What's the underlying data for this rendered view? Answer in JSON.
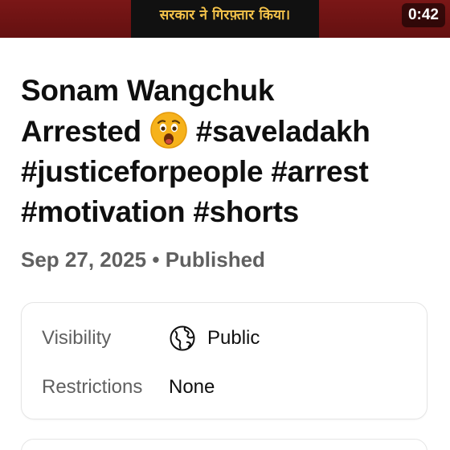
{
  "thumbnail": {
    "caption": "सरकार ने गिरफ़्तार किया।",
    "duration": "0:42"
  },
  "video": {
    "title_line1": "Sonam Wangchuk",
    "title_line2_word": "Arrested",
    "title_line2_tag": "#saveladakh",
    "title_line3": "#justiceforpeople #arrest",
    "title_line4": "#motivation #shorts",
    "emoji": "face-with-open-mouth-icon",
    "date": "Sep 27, 2025",
    "separator": "•",
    "status": "Published"
  },
  "details": {
    "visibility_label": "Visibility",
    "visibility_value": "Public",
    "visibility_icon": "globe-icon",
    "restrictions_label": "Restrictions",
    "restrictions_value": "None"
  },
  "colors": {
    "title": "#0f0f0f",
    "secondary": "#606060",
    "thumbnail_bg": "#6f1414",
    "thumbnail_caption": "#f3c24a"
  }
}
